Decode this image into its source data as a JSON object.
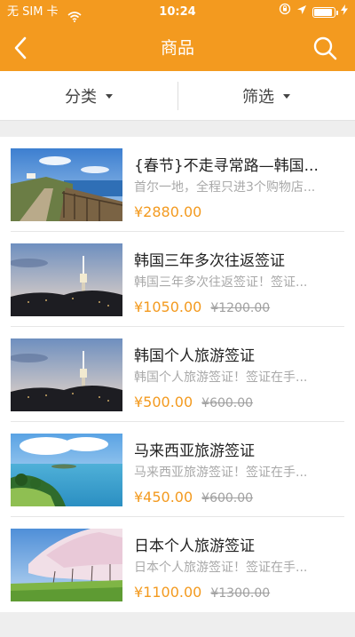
{
  "status": {
    "carrier": "无 SIM 卡",
    "time": "10:24",
    "battery_level": 0.95
  },
  "nav": {
    "title": "商品",
    "back_icon": "chevron-left-icon",
    "search_icon": "search-icon"
  },
  "filters": {
    "category": "分类",
    "filter": "筛选"
  },
  "colors": {
    "accent": "#f39a1f",
    "price": "#f39a1f"
  },
  "products": [
    {
      "title": "{春节}不走寻常路—韩国...",
      "desc": "首尔一地，全程只进3个购物店...",
      "price": "¥2880.00",
      "original_price": "",
      "image": "coastal-road-photo"
    },
    {
      "title": "韩国三年多次往返签证",
      "desc": "韩国三年多次往返签证！签证...",
      "price": "¥1050.00",
      "original_price": "¥1200.00",
      "image": "seoul-tower-dusk-photo"
    },
    {
      "title": "韩国个人旅游签证",
      "desc": "韩国个人旅游签证！签证在手...",
      "price": "¥500.00",
      "original_price": "¥600.00",
      "image": "seoul-tower-dusk-photo"
    },
    {
      "title": "马来西亚旅游签证",
      "desc": "马来西亚旅游签证！签证在手...",
      "price": "¥450.00",
      "original_price": "¥600.00",
      "image": "tropical-bay-photo"
    },
    {
      "title": "日本个人旅游签证",
      "desc": "日本个人旅游签证！签证在手...",
      "price": "¥1100.00",
      "original_price": "¥1300.00",
      "image": "cherry-blossom-photo"
    }
  ]
}
